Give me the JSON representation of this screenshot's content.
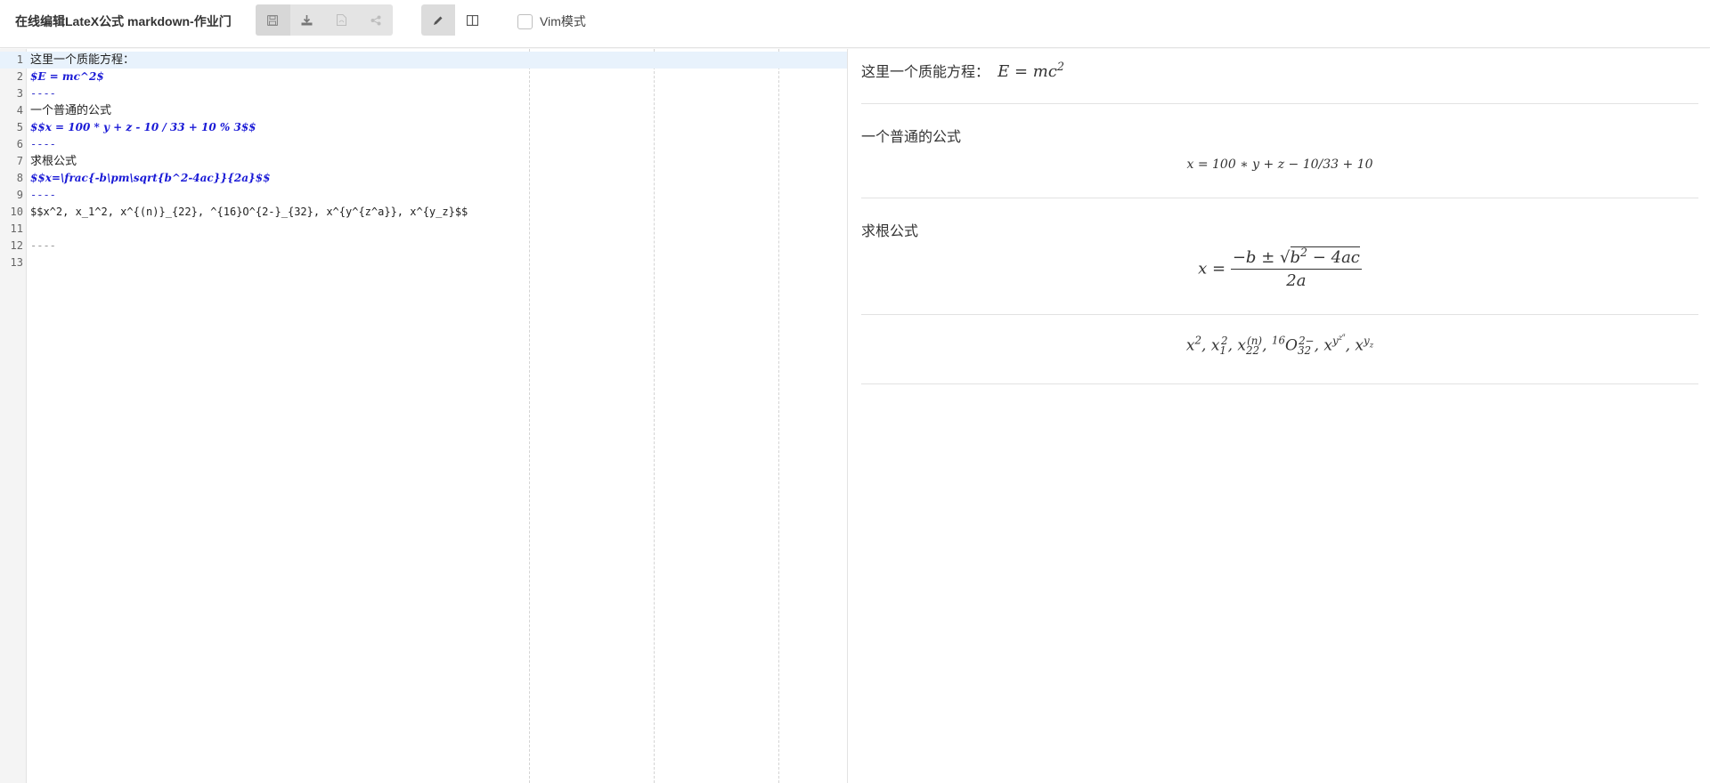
{
  "app": {
    "title": "在线编辑LateX公式 markdown-作业门"
  },
  "toolbar": {
    "vim_label": "Vim模式"
  },
  "editor": {
    "lines": [
      {
        "n": "1",
        "text": "这里一个质能方程："
      },
      {
        "n": "2",
        "text": "$E = mc^2$"
      },
      {
        "n": "3",
        "text": "----"
      },
      {
        "n": "4",
        "text": "一个普通的公式"
      },
      {
        "n": "5",
        "text": "$$x = 100 * y + z - 10 / 33 + 10 % 3$$"
      },
      {
        "n": "6",
        "text": "----"
      },
      {
        "n": "7",
        "text": "求根公式"
      },
      {
        "n": "8",
        "text": "$$x=\\frac{-b\\pm\\sqrt{b^2-4ac}}{2a}$$"
      },
      {
        "n": "9",
        "text": "----"
      },
      {
        "n": "10",
        "text": "$$x^2, x_1^2, x^{(n)}_{22}, ^{16}O^{2-}_{32}, x^{y^{z^a}}, x^{y_z}$$"
      },
      {
        "n": "11",
        "text": ""
      },
      {
        "n": "12",
        "text": "----"
      },
      {
        "n": "13",
        "text": ""
      }
    ]
  },
  "preview": {
    "p1_text": "这里一个质能方程：",
    "p2_text": "一个普通的公式",
    "p3_text": "求根公式",
    "eq_linear": "x = 100 ∗ y + z − 10/33 + 10",
    "eq_emc_lhs": "E = mc",
    "eq_emc_exp": "2"
  }
}
